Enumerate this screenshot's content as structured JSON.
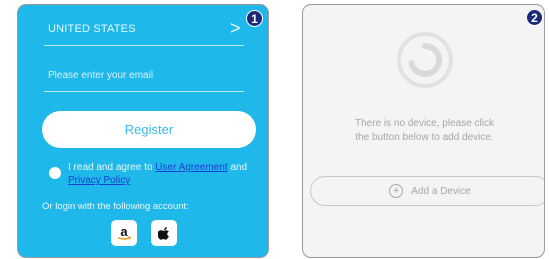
{
  "left_panel": {
    "country": "UNITED STATES",
    "chevron": ">",
    "step_number": "1",
    "email_placeholder": "Please enter your email",
    "register_label": "Register",
    "agreement_prefix": "I read and agree to",
    "user_agreement_link": "User Agreement",
    "agreement_and": "and",
    "privacy_policy_link": "Privacy Policy",
    "login_caption": "Or login with the following account:",
    "social_amazon": "a",
    "social_apple": "apple-icon"
  },
  "right_panel": {
    "step_number": "2",
    "empty_message_line1": "There is no device, please click",
    "empty_message_line2": "the button below to add device.",
    "add_device_plus": "+",
    "add_device_label": "Add a Device"
  },
  "colors": {
    "left_bg": "#1fb8ea",
    "right_bg": "#f4f4f4",
    "link": "#1a3fd1",
    "badge": "#1a2a7a"
  }
}
